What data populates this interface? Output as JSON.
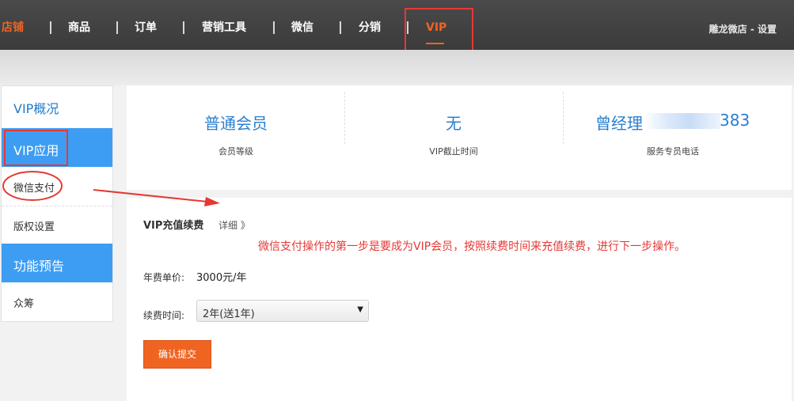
{
  "nav": {
    "items": [
      {
        "label": "店铺"
      },
      {
        "label": "商品"
      },
      {
        "label": "订单"
      },
      {
        "label": "营销工具"
      },
      {
        "label": "微信"
      },
      {
        "label": "分销"
      },
      {
        "label": "VIP"
      }
    ],
    "settings_label": "雕龙微店 - 设置",
    "active_color": "#f06422"
  },
  "sidebar": {
    "items": [
      {
        "label": "VIP概况"
      },
      {
        "label": "VIP应用"
      },
      {
        "label": "微信支付"
      },
      {
        "label": "版权设置"
      },
      {
        "label": "功能预告"
      },
      {
        "label": "众筹"
      }
    ],
    "accent": "#3c9df3"
  },
  "stats": [
    {
      "value": "普通会员",
      "label": "会员等级"
    },
    {
      "value": "无",
      "label": "VIP截止时间"
    },
    {
      "value_prefix": "曾经理",
      "value_suffix": "383",
      "label": "服务专员电话"
    }
  ],
  "recharge": {
    "title": "VIP充值续费",
    "detail_link": "详细 》",
    "annotation": "微信支付操作的第一步是要成为VIP会员，按照续费时间来充值续费，进行下一步操作。",
    "price_label": "年费单价:",
    "price_value": "3000元/年",
    "duration_label": "续费时间:",
    "duration_selected": "2年(送1年)",
    "submit_label": "确认提交"
  },
  "annotation_color": "#e53935"
}
